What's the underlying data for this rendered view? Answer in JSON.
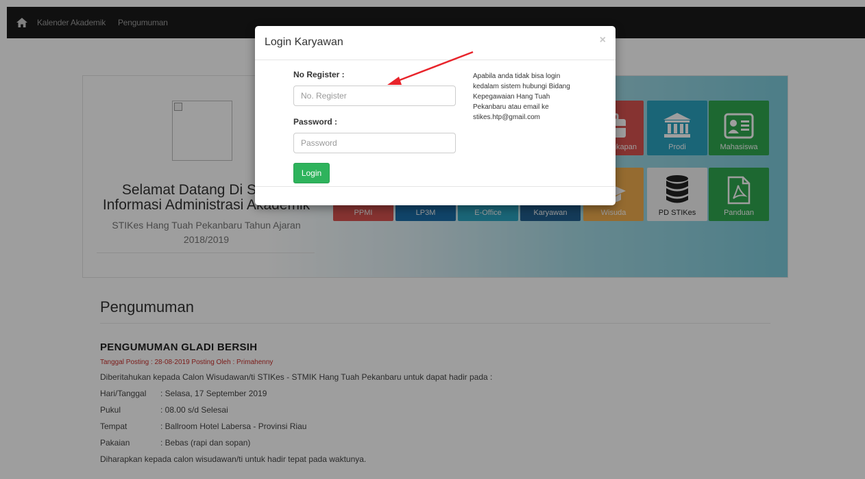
{
  "navbar": {
    "home_icon": "home-icon",
    "links": [
      "Kalender Akademik",
      "Pengumuman"
    ]
  },
  "hero": {
    "title_line1": "Selamat Datang Di Sistem",
    "title_line2": "Informasi Administrasi Akademik",
    "subtitle": "STIKes Hang Tuah Pekanbaru Tahun Ajaran 2018/2019",
    "tiles": [
      {
        "label": "Perlengkapan",
        "color": "#d9534f",
        "icon": "briefcase-icon"
      },
      {
        "label": "Prodi",
        "color": "#2aa3c0",
        "icon": "institution-icon"
      },
      {
        "label": "Mahasiswa",
        "color": "#30a84f",
        "icon": "id-card-icon"
      },
      {
        "label": "PPMI",
        "color": "#d9534f",
        "icon": ""
      },
      {
        "label": "LP3M",
        "color": "#1a6faa",
        "icon": ""
      },
      {
        "label": "E-Office",
        "color": "#2aa3c0",
        "icon": ""
      },
      {
        "label": "Karyawan",
        "color": "#215f90",
        "icon": ""
      },
      {
        "label": "Wisuda",
        "color": "#f0ad4e",
        "icon": "graduation-cap-icon"
      },
      {
        "label": "PD STIKes",
        "color": "#f4f4f4",
        "icon": "database-icon"
      },
      {
        "label": "Panduan",
        "color": "#30a84f",
        "icon": "pdf-icon"
      }
    ]
  },
  "announcements": {
    "section_title": "Pengumuman",
    "post": {
      "title": "PENGUMUMAN GLADI BERSIH",
      "meta": "Tanggal Posting : 28-08-2019   Posting Oleh : Primahenny",
      "intro": "Diberitahukan kepada Calon Wisudawan/ti STIKes - STMIK Hang Tuah Pekanbaru untuk dapat hadir pada :",
      "details": [
        {
          "key": "Hari/Tanggal",
          "value": ": Selasa, 17 September 2019"
        },
        {
          "key": "Pukul",
          "value": ": 08.00 s/d Selesai"
        },
        {
          "key": "Tempat",
          "value": ": Ballroom Hotel Labersa - Provinsi Riau"
        },
        {
          "key": "Pakaian",
          "value": ": Bebas (rapi dan sopan)"
        }
      ],
      "closing": "Diharapkan kepada calon wisudawan/ti untuk hadir tepat pada waktunya."
    }
  },
  "modal": {
    "title": "Login Karyawan",
    "close_symbol": "×",
    "register_label": "No Register :",
    "register_placeholder": "No. Register",
    "password_label": "Password :",
    "password_placeholder": "Password",
    "login_button": "Login",
    "help_text": "Apabila anda tidak bisa login kedalam sistem hubungi Bidang Kepegawaian Hang Tuah Pekanbaru atau email ke stikes.htp@gmail.com",
    "arrow_color": "#e8242b"
  }
}
